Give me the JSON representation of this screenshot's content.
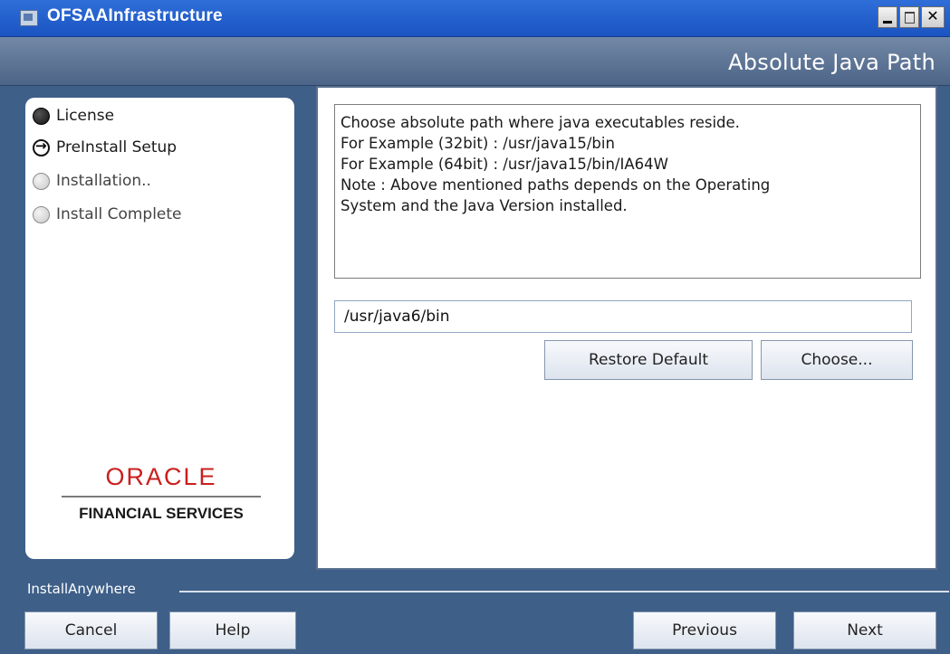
{
  "window": {
    "title": "OFSAAInfrastructure",
    "close_glyph": "✕"
  },
  "header": {
    "title": "Absolute Java Path"
  },
  "steps": [
    {
      "label": "License",
      "state": "done"
    },
    {
      "label": "PreInstall Setup",
      "state": "current"
    },
    {
      "label": "Installation..",
      "state": "pending"
    },
    {
      "label": "Install Complete",
      "state": "pending"
    }
  ],
  "logo": {
    "word": "ORACLE",
    "subtitle": "FINANCIAL SERVICES"
  },
  "description": {
    "lines": [
      "Choose absolute path where java executables reside.",
      "For Example (32bit) : /usr/java15/bin",
      "For Example (64bit) : /usr/java15/bin/IA64W",
      "Note : Above mentioned paths depends on the Operating",
      "System and the Java Version installed."
    ]
  },
  "path_field": {
    "value": "/usr/java6/bin"
  },
  "buttons": {
    "restore_default": "Restore Default",
    "choose": "Choose...",
    "cancel": "Cancel",
    "help": "Help",
    "previous": "Previous",
    "next": "Next"
  },
  "footer": {
    "brand": "InstallAnywhere"
  },
  "colors": {
    "titlebar": "#1a54c2",
    "header": "#5a7293",
    "background": "#3e5f88",
    "oracle_red": "#c8201e"
  }
}
